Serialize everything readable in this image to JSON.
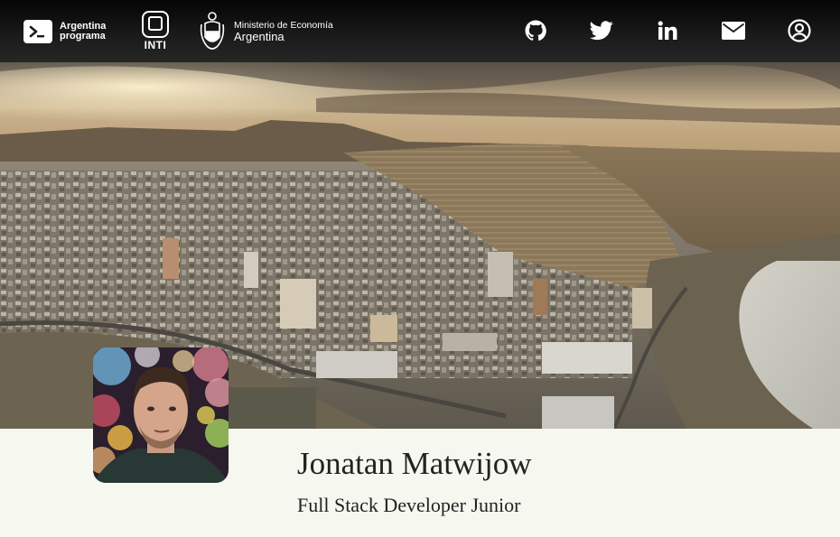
{
  "header": {
    "logos": {
      "argentina_programa": {
        "line1": "Argentina",
        "line2": "programa",
        "icon": "terminal-icon"
      },
      "inti": {
        "text": "INTI",
        "icon": "inti-square-icon"
      },
      "ministerio": {
        "line1": "Ministerio de Economía",
        "line2": "Argentina",
        "icon": "coat-of-arms-icon"
      }
    },
    "social_icons": [
      "github-icon",
      "twitter-icon",
      "linkedin-icon",
      "mail-icon",
      "user-circle-icon"
    ]
  },
  "profile": {
    "name": "Jonatan Matwijow",
    "title": "Full Stack Developer Junior"
  },
  "colors": {
    "header_bg": "#151515",
    "page_bg": "#f6f7ef",
    "text": "#222222"
  }
}
